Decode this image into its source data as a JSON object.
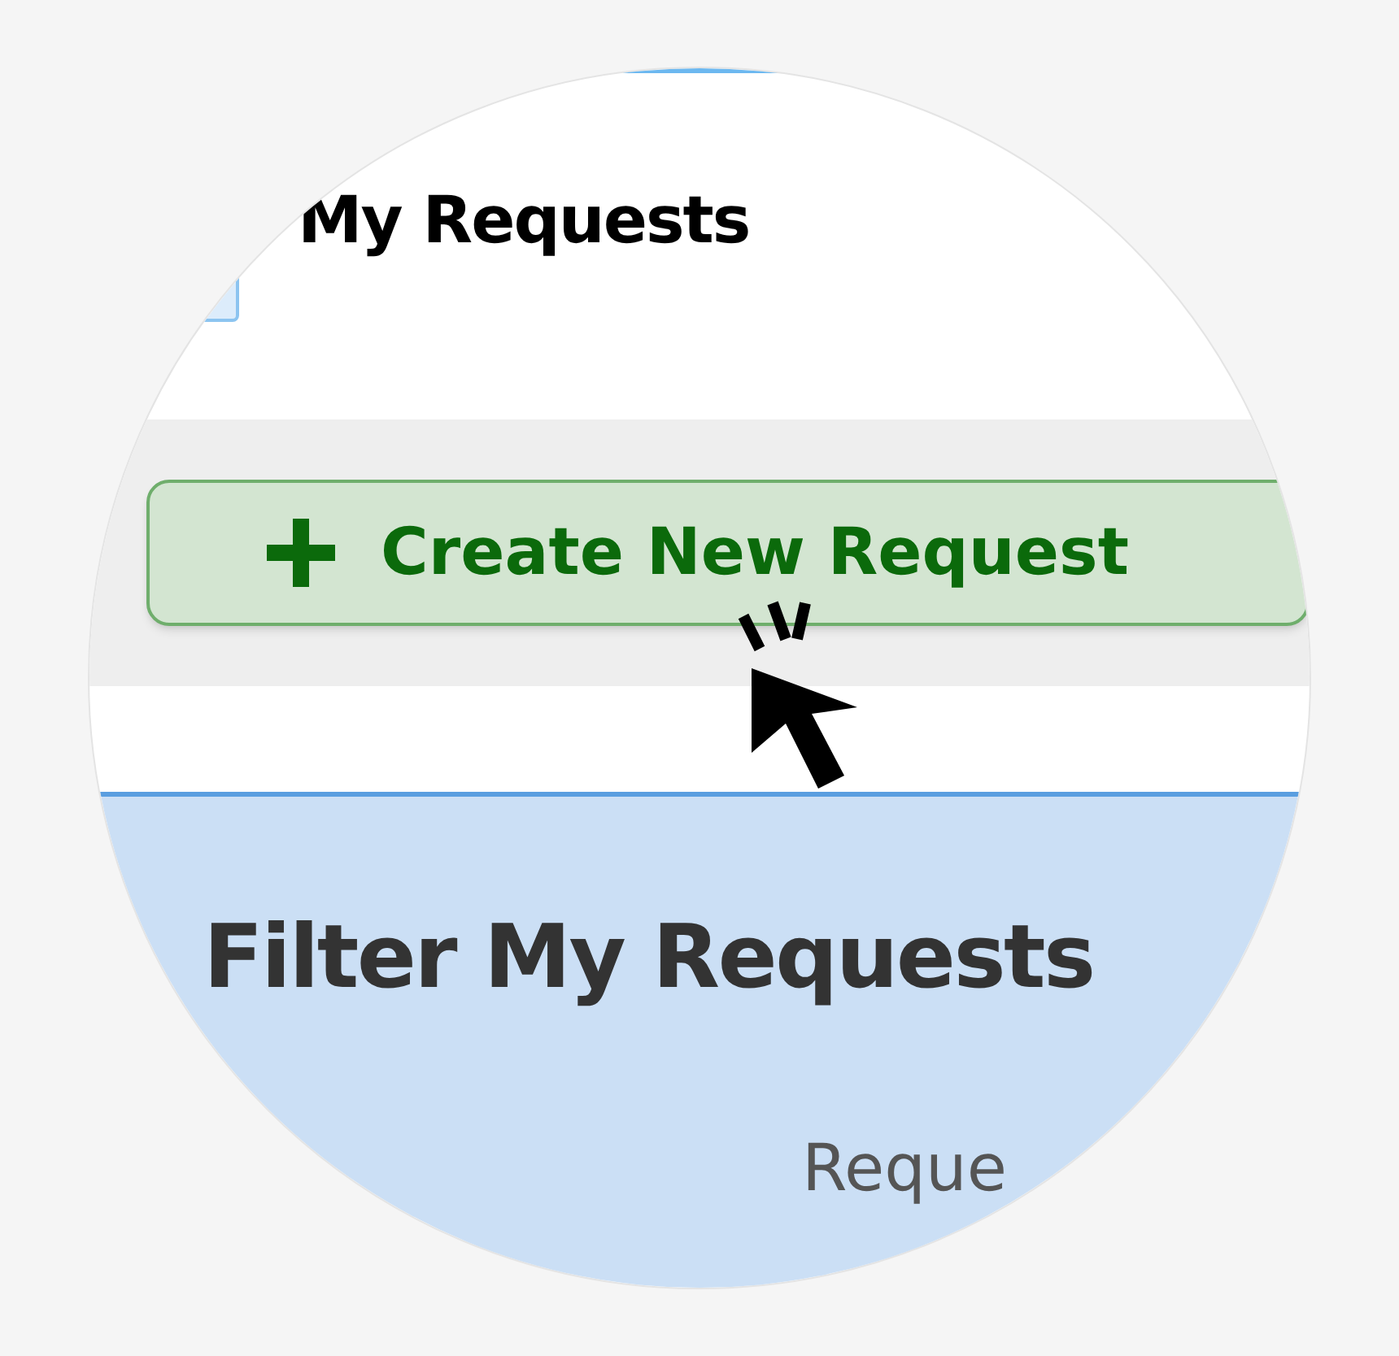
{
  "page": {
    "title": "My Requests"
  },
  "toolbar": {
    "button": {
      "label": "Create New Request"
    }
  },
  "filter_panel": {
    "title": "Filter My Requests",
    "field_label": "Reque"
  }
}
